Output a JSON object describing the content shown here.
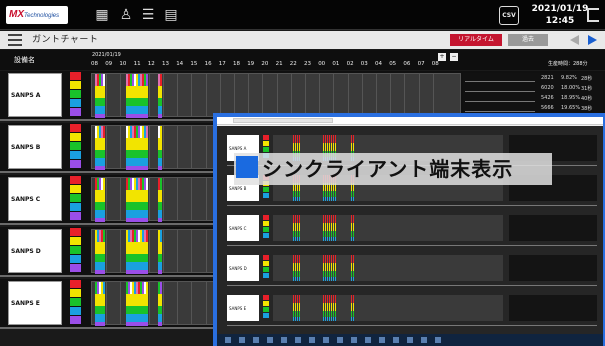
{
  "app": {
    "logo_text": "MX",
    "logo_sub": "Technologies",
    "datetime_date": "2021/01/19",
    "datetime_time": "12:45",
    "icons": [
      "machine-icon",
      "user-group-icon",
      "list-icon",
      "document-icon",
      "csv-icon",
      "logout-icon"
    ],
    "csv_label": "CSV"
  },
  "titlebar": {
    "title": "ガントチャート",
    "realtime_button": "リアルタイム",
    "past_button": "過去",
    "accent_red": "#c4152f",
    "accent_blue": "#1a5fd0"
  },
  "gantt_header": {
    "column_label": "設備名",
    "date": "2021/01/19",
    "hours": [
      "08",
      "09",
      "10",
      "11",
      "12",
      "13",
      "14",
      "15",
      "16",
      "17",
      "18",
      "19",
      "20",
      "21",
      "22",
      "23",
      "00",
      "01",
      "02",
      "03",
      "04",
      "05",
      "06",
      "07",
      "08"
    ],
    "total_label": "生産時間：288分"
  },
  "machines": [
    {
      "name": "SANPS A"
    },
    {
      "name": "SANPS B"
    },
    {
      "name": "SANPS C"
    },
    {
      "name": "SANPS D"
    },
    {
      "name": "SANPS E"
    }
  ],
  "stats_first_row": {
    "rows": [
      {
        "a": "2821",
        "b": "9.82%",
        "c": "28秒"
      },
      {
        "a": "6020",
        "b": "18.00%",
        "c": "31秒"
      },
      {
        "a": "5426",
        "b": "18.95%",
        "c": "40秒"
      },
      {
        "a": "5666",
        "b": "19.65%",
        "c": "38秒"
      }
    ]
  },
  "overlay": {
    "caption": "シンクライアント端末表示",
    "accent": "#2a6fe0"
  },
  "status_colors": {
    "red": "#e8202a",
    "yellow": "#f2e400",
    "green": "#19c22a",
    "blue": "#1aa0e0",
    "purple": "#9a4ee8"
  }
}
